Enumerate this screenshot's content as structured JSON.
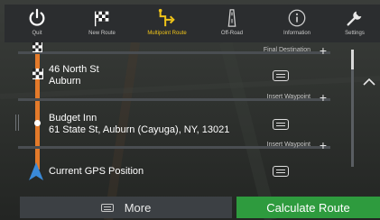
{
  "toolbar": {
    "items": [
      {
        "label": "Quit",
        "icon": "power-icon"
      },
      {
        "label": "New Route",
        "icon": "checkered-flag-icon"
      },
      {
        "label": "Multipoint Route",
        "icon": "multipoint-route-icon",
        "active": true
      },
      {
        "label": "Off-Road",
        "icon": "off-road-icon"
      },
      {
        "label": "Information",
        "icon": "info-icon"
      },
      {
        "label": "Settings",
        "icon": "wrench-icon"
      }
    ],
    "active_color": "#f0c419"
  },
  "route": {
    "final_destination_label": "Final Destination",
    "insert_waypoint_label": "Insert Waypoint",
    "destination": {
      "line1": "46 North St",
      "line2": "Auburn"
    },
    "waypoint": {
      "line1": "Budget Inn",
      "line2": "61 State St, Auburn (Cayuga), NY, 13021"
    },
    "start": {
      "line1": "Current GPS Position"
    },
    "route_color": "#e37a2a"
  },
  "buttons": {
    "more_label": "More",
    "calculate_label": "Calculate Route",
    "calculate_color": "#2e9b3e"
  }
}
